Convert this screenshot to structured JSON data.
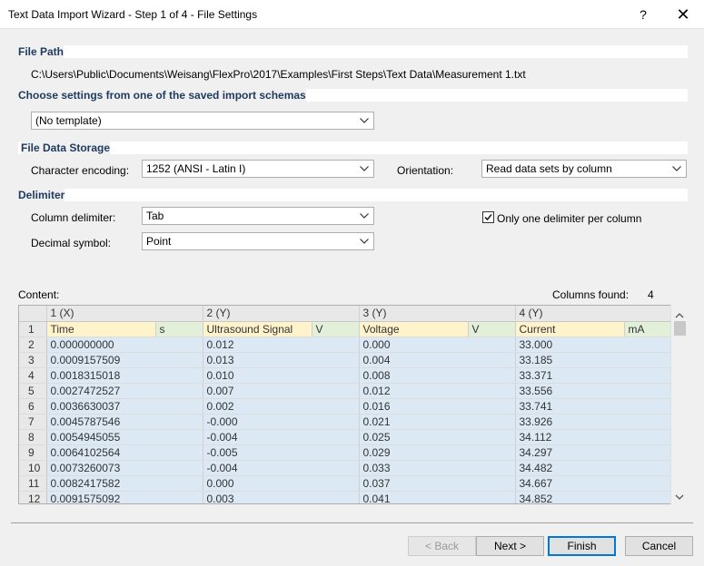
{
  "window": {
    "title": "Text Data Import Wizard - Step 1 of 4 - File Settings",
    "help_glyph": "?",
    "close_glyph": "✕"
  },
  "file_path": {
    "header": "File Path",
    "path": "C:\\Users\\Public\\Documents\\Weisang\\FlexPro\\2017\\Examples\\First Steps\\Text Data\\Measurement 1.txt"
  },
  "schema": {
    "header": "Choose settings from one of the saved import schemas",
    "selected": "(No template)"
  },
  "storage": {
    "header": "File Data Storage",
    "encoding_label": "Character encoding:",
    "encoding_value": "1252  (ANSI - Latin I)",
    "orientation_label": "Orientation:",
    "orientation_value": "Read data sets by column"
  },
  "delimiter": {
    "header": "Delimiter",
    "column_label": "Column delimiter:",
    "column_value": "Tab",
    "decimal_label": "Decimal symbol:",
    "decimal_value": "Point",
    "one_per_column_label": "Only one delimiter per column",
    "one_per_column_checked": true
  },
  "content": {
    "label": "Content:",
    "columns_found_label": "Columns found:",
    "columns_found_value": "4",
    "column_headers": [
      "1 (X)",
      "2 (Y)",
      "3 (Y)",
      "4 (Y)"
    ],
    "names_row": {
      "rownum": "1",
      "cells": [
        "Time",
        "s",
        "Ultrasound Signal",
        "V",
        "Voltage",
        "V",
        "Current",
        "mA"
      ]
    },
    "rows": [
      {
        "n": "2",
        "c": [
          "0.000000000",
          "0.012",
          "0.000",
          "33.000"
        ]
      },
      {
        "n": "3",
        "c": [
          "0.0009157509",
          "0.013",
          "0.004",
          "33.185"
        ]
      },
      {
        "n": "4",
        "c": [
          "0.0018315018",
          "0.010",
          "0.008",
          "33.371"
        ]
      },
      {
        "n": "5",
        "c": [
          "0.0027472527",
          "0.007",
          "0.012",
          "33.556"
        ]
      },
      {
        "n": "6",
        "c": [
          "0.0036630037",
          "0.002",
          "0.016",
          "33.741"
        ]
      },
      {
        "n": "7",
        "c": [
          "0.0045787546",
          "-0.000",
          "0.021",
          "33.926"
        ]
      },
      {
        "n": "8",
        "c": [
          "0.0054945055",
          "-0.004",
          "0.025",
          "34.112"
        ]
      },
      {
        "n": "9",
        "c": [
          "0.0064102564",
          "-0.005",
          "0.029",
          "34.297"
        ]
      },
      {
        "n": "10",
        "c": [
          "0.0073260073",
          "-0.004",
          "0.033",
          "34.482"
        ]
      },
      {
        "n": "11",
        "c": [
          "0.0082417582",
          "0.000",
          "0.037",
          "34.667"
        ]
      },
      {
        "n": "12",
        "c": [
          "0.0091575092",
          "0.003",
          "0.041",
          "34.852"
        ]
      }
    ]
  },
  "buttons": {
    "back": "< Back",
    "next": "Next >",
    "finish": "Finish",
    "cancel": "Cancel"
  }
}
